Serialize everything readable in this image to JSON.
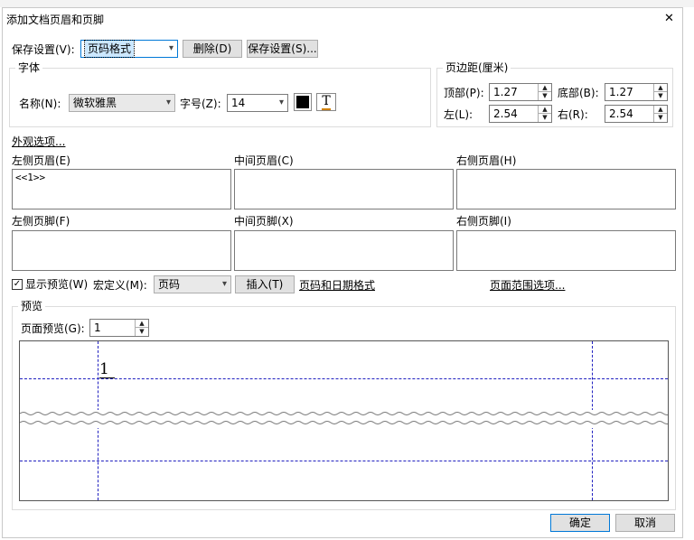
{
  "dialog": {
    "title": "添加文档页眉和页脚",
    "close_glyph": "✕"
  },
  "save_settings": {
    "label": "保存设置(V):",
    "selected": "页码格式",
    "delete_button": "删除(D)",
    "save_button": "保存设置(S)..."
  },
  "font": {
    "group_title": "字体",
    "name_label": "名称(N):",
    "name_value": "微软雅黑",
    "size_label": "字号(Z):",
    "size_value": "14",
    "color": "#000000"
  },
  "margins": {
    "group_title": "页边距(厘米)",
    "top_label": "顶部(P):",
    "top_value": "1.27",
    "bottom_label": "底部(B):",
    "bottom_value": "1.27",
    "left_label": "左(L):",
    "left_value": "2.54",
    "right_label": "右(R):",
    "right_value": "2.54"
  },
  "appearance_link": "外观选项...",
  "header": {
    "left_label": "左侧页眉(E)",
    "left_value": "<<1>>",
    "center_label": "中间页眉(C)",
    "center_value": "",
    "right_label": "右侧页眉(H)",
    "right_value": ""
  },
  "footer": {
    "left_label": "左侧页脚(F)",
    "left_value": "",
    "center_label": "中间页脚(X)",
    "center_value": "",
    "right_label": "右侧页脚(I)",
    "right_value": ""
  },
  "options": {
    "show_preview_label": "显示预览(W)",
    "show_preview_checked": true,
    "macro_label": "宏定义(M):",
    "macro_value": "页码",
    "insert_button": "插入(T)",
    "date_format_link": "页码和日期格式",
    "page_range_link": "页面范围选项..."
  },
  "preview": {
    "group_title": "预览",
    "page_label": "页面预览(G):",
    "page_value": "1",
    "sample_text": "1"
  },
  "actions": {
    "ok": "确定",
    "cancel": "取消"
  }
}
